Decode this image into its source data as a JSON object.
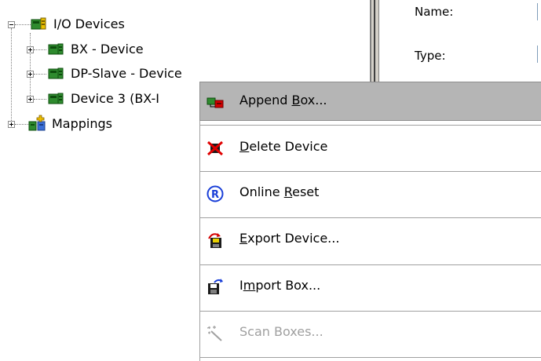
{
  "tree": {
    "root": {
      "label": "I/O Devices",
      "icon": "io-devices-icon",
      "expander": "minus"
    },
    "children": [
      {
        "label": "BX - Device",
        "icon": "device-icon",
        "expander": "plus"
      },
      {
        "label": "DP-Slave - Device",
        "icon": "device-icon",
        "expander": "plus"
      },
      {
        "label": "Device 3 (BX-I",
        "icon": "device-icon",
        "expander": "plus"
      }
    ],
    "mappings": {
      "label": "Mappings",
      "icon": "mappings-icon",
      "expander": "plus"
    }
  },
  "properties": {
    "name_label": "Name:",
    "type_label": "Type:"
  },
  "context_menu": {
    "items": [
      {
        "pre": "Append ",
        "mn": "B",
        "post": "ox...",
        "icon": "append-box-icon",
        "enabled": true,
        "highlighted": true
      },
      {
        "pre": "",
        "mn": "D",
        "post": "elete Device",
        "icon": "delete-device-icon",
        "enabled": true,
        "highlighted": false
      },
      {
        "pre": "Online ",
        "mn": "R",
        "post": "eset",
        "icon": "online-reset-icon",
        "enabled": true,
        "highlighted": false
      },
      {
        "pre": "",
        "mn": "E",
        "post": "xport Device...",
        "icon": "export-device-icon",
        "enabled": true,
        "highlighted": false
      },
      {
        "pre": "I",
        "mn": "m",
        "post": "port Box...",
        "icon": "import-box-icon",
        "enabled": true,
        "highlighted": false
      },
      {
        "pre": "Scan Boxes...",
        "mn": "",
        "post": "",
        "icon": "scan-boxes-icon",
        "enabled": false,
        "highlighted": false
      }
    ]
  },
  "colors": {
    "menu_highlight": "#b5b5b5",
    "device_green": "#2e8b2e",
    "disabled_text": "#a0a0a0"
  }
}
